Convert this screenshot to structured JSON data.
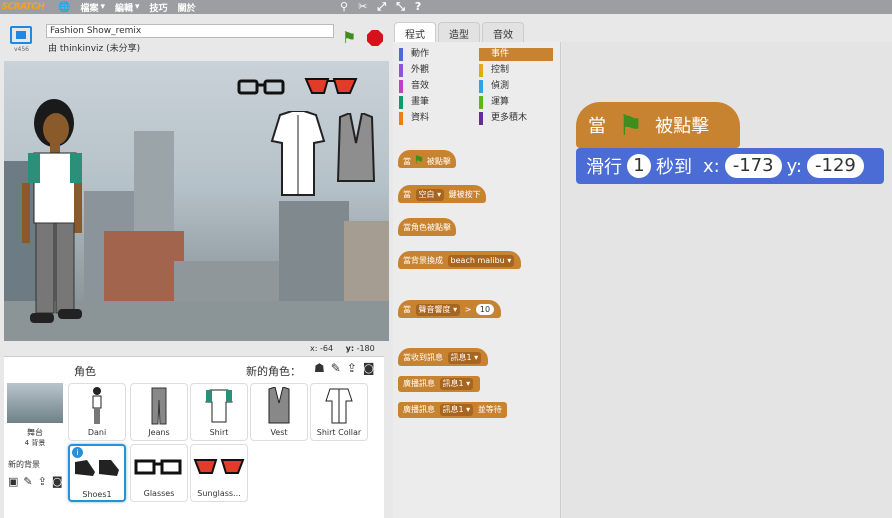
{
  "menu": {
    "logo": "SCRATCH",
    "file": "檔案",
    "edit": "編輯",
    "tips": "技巧",
    "about": "關於"
  },
  "stage_header": {
    "project_title": "Fashion Show_remix",
    "author": "由 thinkinviz (未分享)",
    "version": "v456"
  },
  "stage_coords": {
    "x_label": "x:",
    "x_value": "-64",
    "y_label": "y:",
    "y_value": "-180"
  },
  "sprite_pane": {
    "title": "角色",
    "new_sprite_label": "新的角色：",
    "stage_label": "舞台",
    "backdrop_count": "4 背景",
    "new_backdrop_label": "新的背景",
    "sprites": [
      {
        "name": "Dani"
      },
      {
        "name": "Jeans"
      },
      {
        "name": "Shirt"
      },
      {
        "name": "Vest"
      },
      {
        "name": "Shirt Collar"
      },
      {
        "name": "Shoes1",
        "selected": true
      },
      {
        "name": "Glasses"
      },
      {
        "name": "Sunglass..."
      }
    ]
  },
  "tabs": [
    "程式",
    "造型",
    "音效"
  ],
  "categories": [
    {
      "label": "動作",
      "color": "#4a6cd4"
    },
    {
      "label": "事件",
      "color": "#c88330",
      "active": true
    },
    {
      "label": "外觀",
      "color": "#8a55d7"
    },
    {
      "label": "控制",
      "color": "#e1a91a"
    },
    {
      "label": "音效",
      "color": "#bb42c3"
    },
    {
      "label": "偵測",
      "color": "#2ca5e2"
    },
    {
      "label": "畫筆",
      "color": "#0e9a6c"
    },
    {
      "label": "運算",
      "color": "#5cb712"
    },
    {
      "label": "資料",
      "color": "#ee7d16"
    },
    {
      "label": "更多積木",
      "color": "#632d99"
    }
  ],
  "palette_blocks": {
    "when_flag_pre": "當",
    "when_flag_post": "被點擊",
    "when_key_pre": "當",
    "when_key_slot": "空白",
    "when_key_post": "鍵被按下",
    "when_sprite_clicked": "當角色被點擊",
    "when_backdrop_pre": "當背景換成",
    "when_backdrop_slot": "beach malibu",
    "when_loud_pre": "當",
    "when_loud_slot": "聲音響度",
    "when_loud_op": ">",
    "when_loud_value": "10",
    "when_receive_pre": "當收到訊息",
    "when_receive_slot": "訊息1",
    "broadcast_pre": "廣播訊息",
    "broadcast_slot": "訊息1",
    "broadcast_wait_pre": "廣播訊息",
    "broadcast_wait_slot": "訊息1",
    "broadcast_wait_post": "並等待"
  },
  "script": {
    "hat_pre": "當",
    "hat_post": "被點擊",
    "glide_label": "滑行",
    "glide_secs": "1",
    "glide_secs_label": "秒到",
    "x_label": "x:",
    "x_value": "-173",
    "y_label": "y:",
    "y_value": "-129"
  },
  "colors": {
    "events": "#c88330",
    "motion": "#4a6cd4",
    "menubar": "#9c9ea2",
    "selected_border": "#2b8fd6"
  }
}
